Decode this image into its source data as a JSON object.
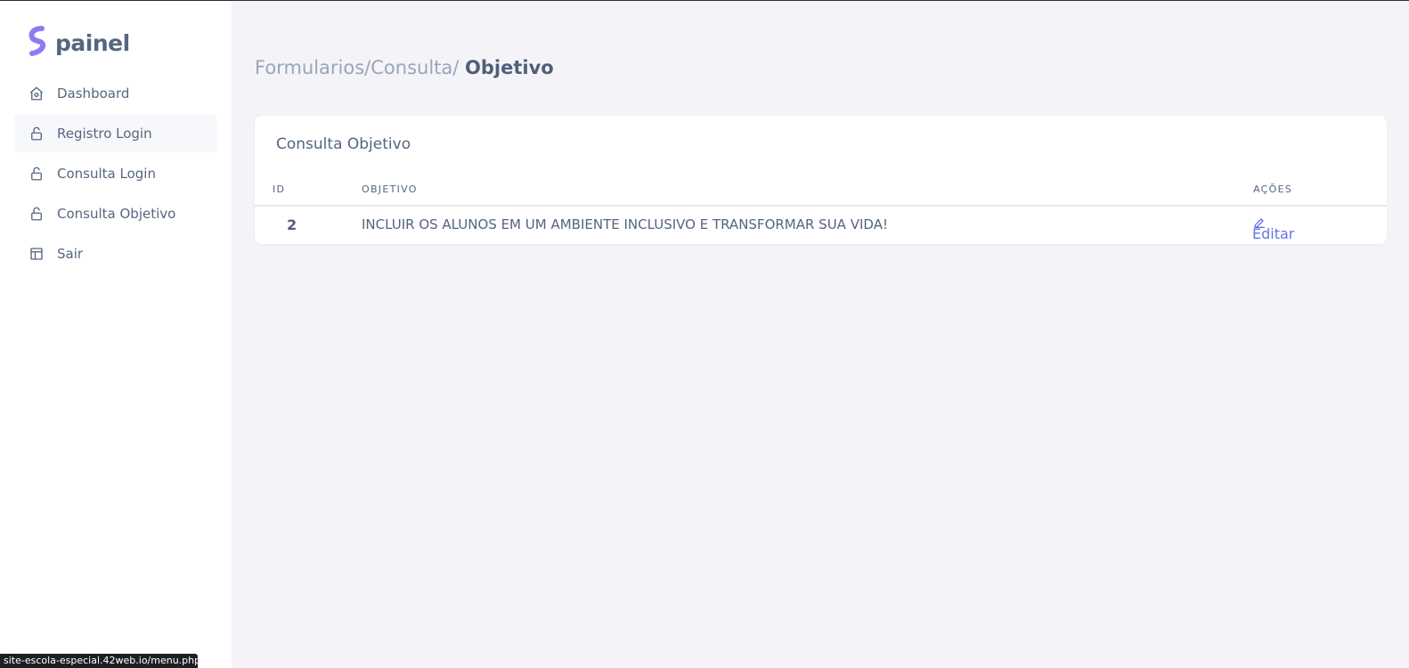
{
  "brand": {
    "name": "painel",
    "color": "#8b7cf6"
  },
  "sidebar": {
    "items": [
      {
        "label": "Dashboard",
        "icon": "home-icon",
        "active": false
      },
      {
        "label": "Registro Login",
        "icon": "lock-open-icon",
        "active": true
      },
      {
        "label": "Consulta Login",
        "icon": "lock-open-icon",
        "active": false
      },
      {
        "label": "Consulta Objetivo",
        "icon": "lock-open-icon",
        "active": false
      },
      {
        "label": "Sair",
        "icon": "layout-icon",
        "active": false
      }
    ]
  },
  "breadcrumb": {
    "path": "Formularios/Consulta/",
    "current": "Objetivo"
  },
  "card": {
    "title": "Consulta Objetivo",
    "columns": [
      "ID",
      "OBJETIVO",
      "AÇÕES"
    ],
    "rows": [
      {
        "id": "2",
        "objetivo": "INCLUIR OS ALUNOS EM UM AMBIENTE INCLUSIVO E TRANSFORMAR SUA VIDA!",
        "action": "Editar"
      }
    ]
  },
  "statusbar": {
    "url": "site-escola-especial.42web.io/menu.php"
  },
  "colors": {
    "accent": "#6773e8",
    "text": "#55657e",
    "background": "#f4f4f8"
  }
}
